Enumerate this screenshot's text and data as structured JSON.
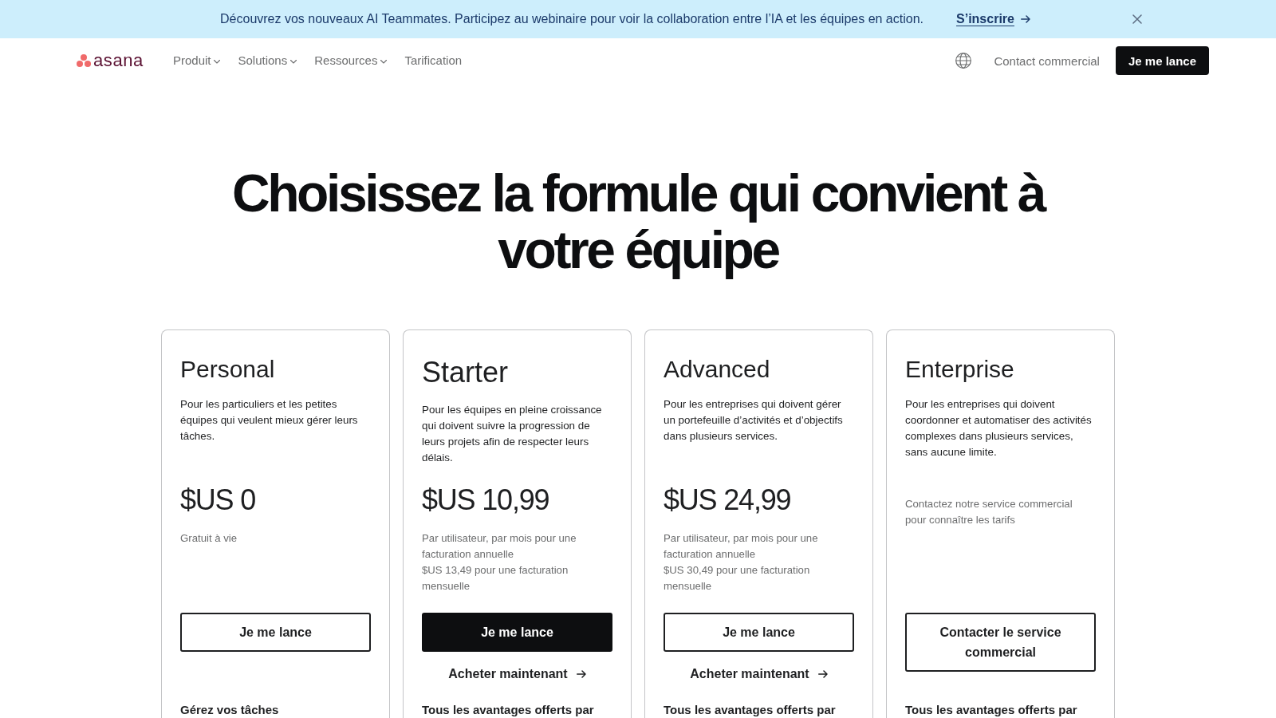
{
  "banner": {
    "message": "Découvrez vos nouveaux AI Teammates. Participez au webinaire pour voir la collaboration entre l’IA et les équipes en action.",
    "link": "S’inscrire"
  },
  "nav": {
    "logo": "asana",
    "items": [
      {
        "label": "Produit",
        "dropdown": true
      },
      {
        "label": "Solutions",
        "dropdown": true
      },
      {
        "label": "Ressources",
        "dropdown": true
      },
      {
        "label": "Tarification",
        "dropdown": false
      }
    ],
    "contact": "Contact commercial",
    "cta": "Je me lance"
  },
  "hero": {
    "title": "Choisissez la formule qui convient à votre équipe"
  },
  "plans": [
    {
      "name": "Personal",
      "featured": false,
      "description": "Pour les particuliers et les petites équipes qui veulent mieux gérer leurs tâches.",
      "price": "$US 0",
      "notes": [
        "Gratuit à vie"
      ],
      "cta": "Je me lance",
      "features_heading": "Gérez vos tâches"
    },
    {
      "name": "Starter",
      "featured": true,
      "description": "Pour les équipes en pleine croissance qui doivent suivre la progression de leurs projets afin de respecter leurs délais.",
      "price": "$US 10,99",
      "notes": [
        "Par utilisateur, par mois pour une facturation annuelle",
        "$US 13,49 pour une facturation mensuelle"
      ],
      "cta": "Je me lance",
      "buy_link": "Acheter maintenant",
      "features_heading": "Tous les avantages offerts par"
    },
    {
      "name": "Advanced",
      "featured": false,
      "description": "Pour les entreprises qui doivent gérer un portefeuille d’activités et d’objectifs dans plusieurs services.",
      "price": "$US 24,99",
      "notes": [
        "Par utilisateur, par mois pour une facturation annuelle",
        "$US 30,49 pour une facturation mensuelle"
      ],
      "cta": "Je me lance",
      "buy_link": "Acheter maintenant",
      "features_heading": "Tous les avantages offerts par"
    },
    {
      "name": "Enterprise",
      "featured": false,
      "description": "Pour les entreprises qui doivent coordonner et automatiser des activités complexes dans plusieurs services, sans aucune limite.",
      "notes": [
        "Contactez notre service commercial pour connaître les tarifs"
      ],
      "cta": "Contacter le service commercial",
      "features_heading": "Tous les avantages offerts par"
    }
  ]
}
